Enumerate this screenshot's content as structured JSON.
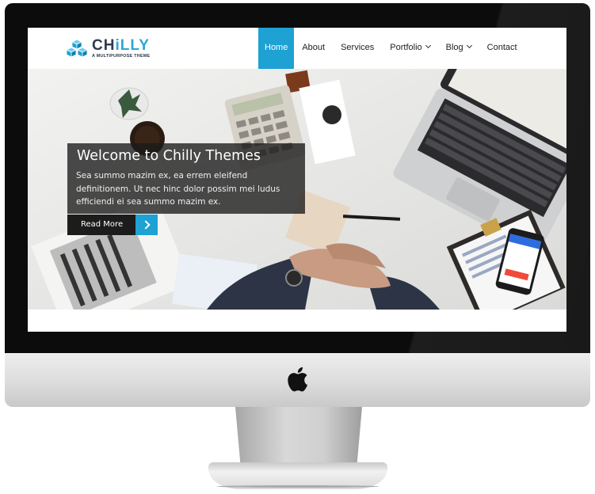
{
  "brand": {
    "name_dark": "CH",
    "name_blue": "iLLY",
    "tagline": "A MULTIPURPOSE THEME"
  },
  "nav": {
    "items": [
      {
        "label": "Home"
      },
      {
        "label": "About"
      },
      {
        "label": "Services"
      },
      {
        "label": "Portfolio"
      },
      {
        "label": "Blog"
      },
      {
        "label": "Contact"
      }
    ],
    "active": "Home"
  },
  "hero": {
    "title": "Welcome to Chilly Themes",
    "text": "Sea summo mazim ex, ea errem eleifend definitionem. Ut nec hinc dolor possim mei ludus efficiendi ei sea summo mazim ex.",
    "button_label": "Read More"
  },
  "colors": {
    "accent": "#1ea1d3",
    "brand_dark": "#2e3a4d",
    "bezel": "#0c0c0c"
  },
  "icons": {
    "brand": "cubes-logo-icon",
    "button": "chevron-right-icon",
    "menu_dropdown": "chevron-down-icon",
    "device": "apple-logo-icon"
  }
}
